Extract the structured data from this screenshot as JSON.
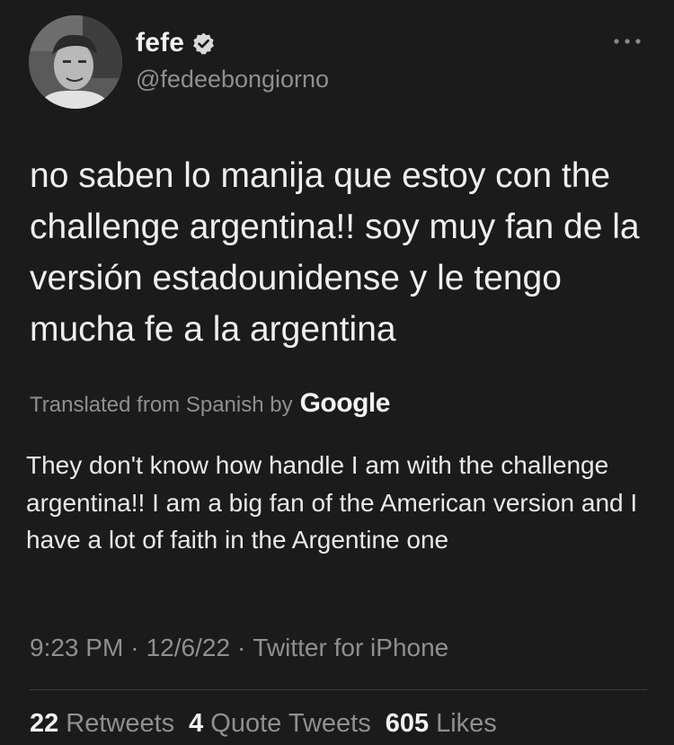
{
  "author": {
    "display_name": "fefe",
    "handle": "@fedeebongiorno",
    "verified_icon": "verified-badge-icon",
    "avatar_icon": "profile-photo"
  },
  "more_icon": "more-options-icon",
  "tweet": {
    "text": "no saben lo manija que estoy con the challenge argentina!! soy muy fan de la versión estadounidense y le tengo mucha fe a la argentina"
  },
  "translation": {
    "label": "Translated from Spanish by",
    "provider": "Google",
    "text": "They don't know how handle I am with the challenge argentina!! I am a big fan of the American version and I have a lot of faith in the Argentine one"
  },
  "meta": {
    "time": "9:23 PM",
    "date": "12/6/22",
    "source": "Twitter for iPhone",
    "separator": "·"
  },
  "stats": [
    {
      "count": "22",
      "label": "Retweets"
    },
    {
      "count": "4",
      "label": "Quote Tweets"
    },
    {
      "count": "605",
      "label": "Likes"
    }
  ],
  "colors": {
    "background": "#1b1b1b",
    "text": "#efefef",
    "secondary": "#8f8f8f",
    "divider": "#3a3a3a"
  }
}
